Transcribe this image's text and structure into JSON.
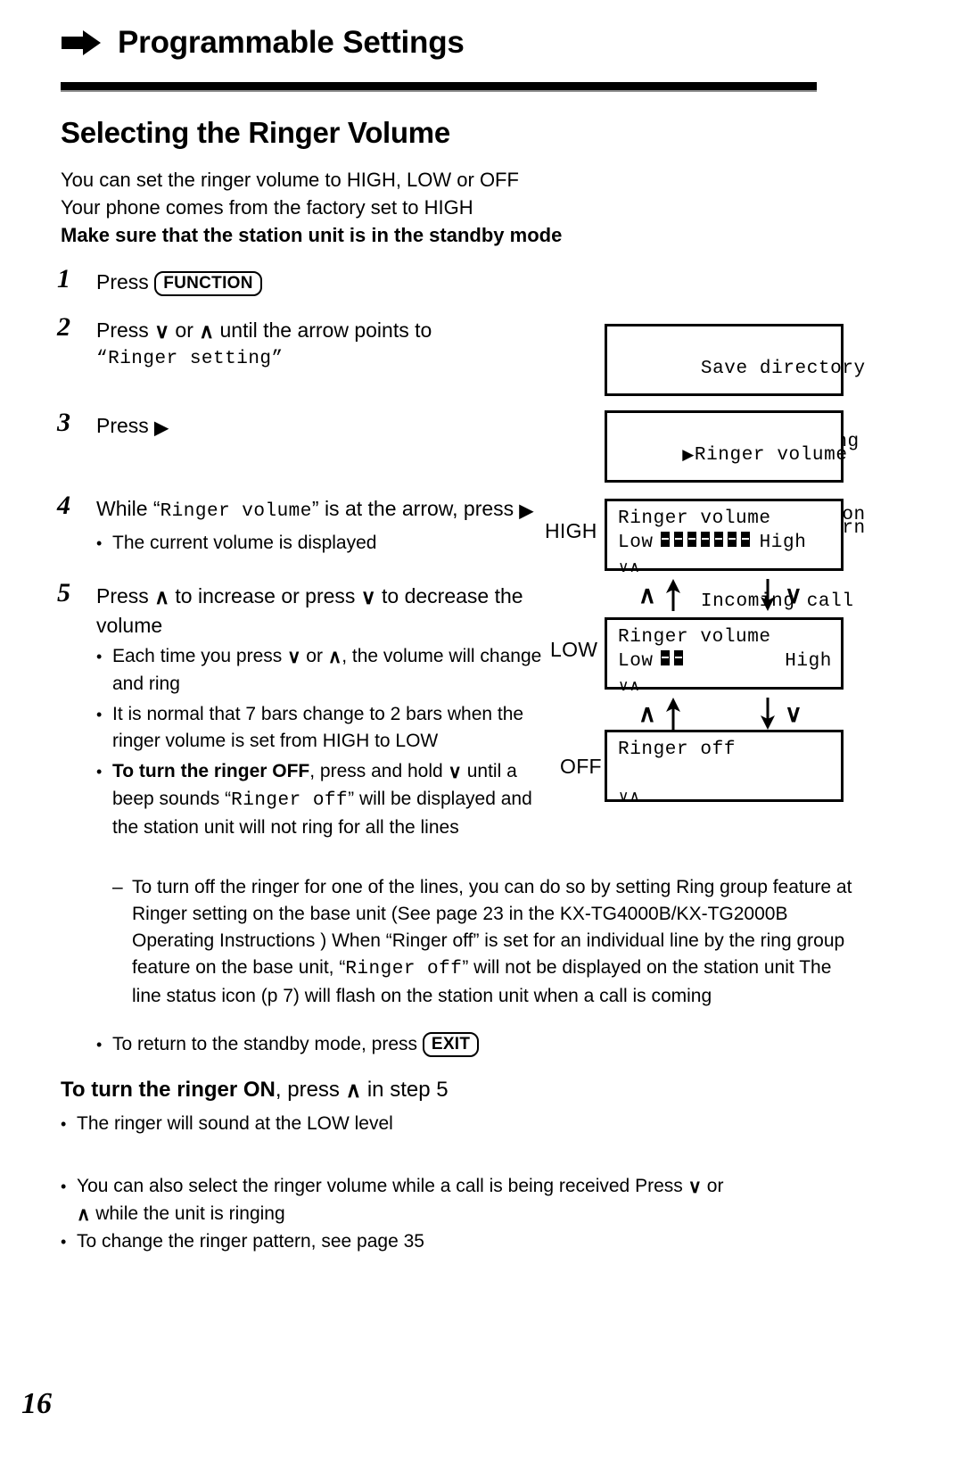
{
  "header": {
    "title": "Programmable Settings",
    "bullet_icon": "right-arrow-icon"
  },
  "section": {
    "title": "Selecting the Ringer Volume",
    "intro_line_1": "You can set the ringer volume to HIGH, LOW or OFF",
    "intro_line_2": "Your phone comes from the factory set to HIGH",
    "intro_line_3_bold": "Make sure that the station unit is in the standby mode"
  },
  "steps": [
    {
      "number": "1",
      "text_before": "Press ",
      "keycap": "FUNCTION",
      "text_after": ""
    },
    {
      "number": "2",
      "text_a": "Press ",
      "glyph_down": "∨",
      "text_b": " or ",
      "glyph_up": "∧",
      "text_c": " until the arrow points to",
      "quoted_mono": "“Ringer setting”"
    },
    {
      "number": "3",
      "text": "Press ",
      "glyph_right": "▶"
    },
    {
      "number": "4",
      "text_a": "While “",
      "mono": "Ringer volume",
      "text_b": "” is at the arrow, press ",
      "glyph_right": "▶",
      "sub": "The current volume is displayed"
    },
    {
      "number": "5",
      "text_a": "Press ",
      "glyph_up": "∧",
      "text_b": " to increase or press ",
      "glyph_down": "∨",
      "text_c": " to decrease the volume"
    }
  ],
  "step5_bullets": {
    "b1_a": "Each time you press ",
    "b1_down": "∨",
    "b1_b": " or ",
    "b1_up": "∧",
    "b1_c": ", the volume will change and ring",
    "b2": "It is normal that 7 bars change to 2 bars when the ringer volume is set from HIGH to LOW",
    "b3_bold": "To turn the ringer OFF",
    "b3_a": ", press and hold ",
    "b3_down": "∨",
    "b3_b": " until a beep sounds “",
    "b3_mono": "Ringer off",
    "b3_c": "” will be displayed and the station unit will not ring for all the lines",
    "dash_a": "To turn off the ringer for one of the lines, you can do so by setting Ring group feature at Ringer setting on the base unit  (See page 23 in the KX-TG4000B/KX-TG2000B Operating Instructions ) When “Ringer off” is set for an individual line by the ring group feature on the base unit, “",
    "dash_mono1": "Ringer off",
    "dash_b": "” will not be displayed on the station unit  The line status icon (p  7) will flash on the station unit when a call is coming",
    "b4_a": "To return to the standby mode, press ",
    "b4_keycap": "EXIT"
  },
  "lcd_screens": [
    {
      "name": "menu-1",
      "lines": [
        {
          "pointer": false,
          "text": "Save directory"
        },
        {
          "pointer": true,
          "text": "Ringer setting"
        },
        {
          "pointer": false,
          "text": "Line selection"
        }
      ]
    },
    {
      "name": "menu-2",
      "lines": [
        {
          "pointer": true,
          "text": "Ringer volume"
        },
        {
          "pointer": false,
          "text": "Ringer pattern"
        },
        {
          "pointer": false,
          "text": "Incoming call"
        }
      ]
    },
    {
      "name": "volume-high",
      "label": "HIGH",
      "title": "Ringer volume",
      "low_label": "Low",
      "high_label": "High",
      "bars": 7,
      "nav": "∨∧"
    },
    {
      "name": "volume-low",
      "label": "LOW",
      "title": "Ringer volume",
      "low_label": "Low",
      "high_label": "High",
      "bars": 2,
      "nav": "∨∧"
    },
    {
      "name": "ringer-off",
      "label": "OFF",
      "title": "Ringer off",
      "nav": "∨∧"
    }
  ],
  "connectors": {
    "up_caret": "∧",
    "up_arrow": "↑",
    "down_arrow": "↓",
    "down_caret": "∨"
  },
  "bottom": {
    "turn_on_bold": "To turn the ringer ON",
    "turn_on_a": ", press ",
    "turn_on_glyph": "∧",
    "turn_on_b": " in step 5",
    "turn_on_bullet": "The ringer will sound at the LOW level",
    "note1_a": "You can also select the ringer volume while a call is being received  Press ",
    "note1_down": "∨",
    "note1_b": " or ",
    "note1_up": "∧",
    "note1_c": " while the unit is ringing",
    "note2": "To change the ringer pattern, see page 35"
  },
  "page_number": "16"
}
